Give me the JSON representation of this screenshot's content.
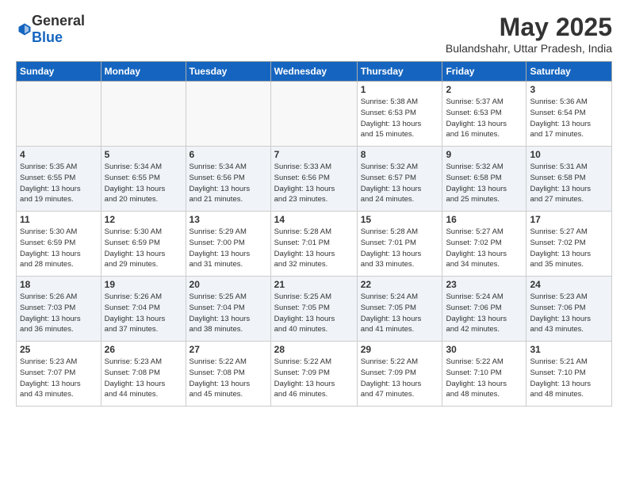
{
  "logo": {
    "general": "General",
    "blue": "Blue"
  },
  "header": {
    "title": "May 2025",
    "subtitle": "Bulandshahr, Uttar Pradesh, India"
  },
  "weekdays": [
    "Sunday",
    "Monday",
    "Tuesday",
    "Wednesday",
    "Thursday",
    "Friday",
    "Saturday"
  ],
  "weeks": [
    [
      {
        "day": "",
        "info": ""
      },
      {
        "day": "",
        "info": ""
      },
      {
        "day": "",
        "info": ""
      },
      {
        "day": "",
        "info": ""
      },
      {
        "day": "1",
        "info": "Sunrise: 5:38 AM\nSunset: 6:53 PM\nDaylight: 13 hours\nand 15 minutes."
      },
      {
        "day": "2",
        "info": "Sunrise: 5:37 AM\nSunset: 6:53 PM\nDaylight: 13 hours\nand 16 minutes."
      },
      {
        "day": "3",
        "info": "Sunrise: 5:36 AM\nSunset: 6:54 PM\nDaylight: 13 hours\nand 17 minutes."
      }
    ],
    [
      {
        "day": "4",
        "info": "Sunrise: 5:35 AM\nSunset: 6:55 PM\nDaylight: 13 hours\nand 19 minutes."
      },
      {
        "day": "5",
        "info": "Sunrise: 5:34 AM\nSunset: 6:55 PM\nDaylight: 13 hours\nand 20 minutes."
      },
      {
        "day": "6",
        "info": "Sunrise: 5:34 AM\nSunset: 6:56 PM\nDaylight: 13 hours\nand 21 minutes."
      },
      {
        "day": "7",
        "info": "Sunrise: 5:33 AM\nSunset: 6:56 PM\nDaylight: 13 hours\nand 23 minutes."
      },
      {
        "day": "8",
        "info": "Sunrise: 5:32 AM\nSunset: 6:57 PM\nDaylight: 13 hours\nand 24 minutes."
      },
      {
        "day": "9",
        "info": "Sunrise: 5:32 AM\nSunset: 6:58 PM\nDaylight: 13 hours\nand 25 minutes."
      },
      {
        "day": "10",
        "info": "Sunrise: 5:31 AM\nSunset: 6:58 PM\nDaylight: 13 hours\nand 27 minutes."
      }
    ],
    [
      {
        "day": "11",
        "info": "Sunrise: 5:30 AM\nSunset: 6:59 PM\nDaylight: 13 hours\nand 28 minutes."
      },
      {
        "day": "12",
        "info": "Sunrise: 5:30 AM\nSunset: 6:59 PM\nDaylight: 13 hours\nand 29 minutes."
      },
      {
        "day": "13",
        "info": "Sunrise: 5:29 AM\nSunset: 7:00 PM\nDaylight: 13 hours\nand 31 minutes."
      },
      {
        "day": "14",
        "info": "Sunrise: 5:28 AM\nSunset: 7:01 PM\nDaylight: 13 hours\nand 32 minutes."
      },
      {
        "day": "15",
        "info": "Sunrise: 5:28 AM\nSunset: 7:01 PM\nDaylight: 13 hours\nand 33 minutes."
      },
      {
        "day": "16",
        "info": "Sunrise: 5:27 AM\nSunset: 7:02 PM\nDaylight: 13 hours\nand 34 minutes."
      },
      {
        "day": "17",
        "info": "Sunrise: 5:27 AM\nSunset: 7:02 PM\nDaylight: 13 hours\nand 35 minutes."
      }
    ],
    [
      {
        "day": "18",
        "info": "Sunrise: 5:26 AM\nSunset: 7:03 PM\nDaylight: 13 hours\nand 36 minutes."
      },
      {
        "day": "19",
        "info": "Sunrise: 5:26 AM\nSunset: 7:04 PM\nDaylight: 13 hours\nand 37 minutes."
      },
      {
        "day": "20",
        "info": "Sunrise: 5:25 AM\nSunset: 7:04 PM\nDaylight: 13 hours\nand 38 minutes."
      },
      {
        "day": "21",
        "info": "Sunrise: 5:25 AM\nSunset: 7:05 PM\nDaylight: 13 hours\nand 40 minutes."
      },
      {
        "day": "22",
        "info": "Sunrise: 5:24 AM\nSunset: 7:05 PM\nDaylight: 13 hours\nand 41 minutes."
      },
      {
        "day": "23",
        "info": "Sunrise: 5:24 AM\nSunset: 7:06 PM\nDaylight: 13 hours\nand 42 minutes."
      },
      {
        "day": "24",
        "info": "Sunrise: 5:23 AM\nSunset: 7:06 PM\nDaylight: 13 hours\nand 43 minutes."
      }
    ],
    [
      {
        "day": "25",
        "info": "Sunrise: 5:23 AM\nSunset: 7:07 PM\nDaylight: 13 hours\nand 43 minutes."
      },
      {
        "day": "26",
        "info": "Sunrise: 5:23 AM\nSunset: 7:08 PM\nDaylight: 13 hours\nand 44 minutes."
      },
      {
        "day": "27",
        "info": "Sunrise: 5:22 AM\nSunset: 7:08 PM\nDaylight: 13 hours\nand 45 minutes."
      },
      {
        "day": "28",
        "info": "Sunrise: 5:22 AM\nSunset: 7:09 PM\nDaylight: 13 hours\nand 46 minutes."
      },
      {
        "day": "29",
        "info": "Sunrise: 5:22 AM\nSunset: 7:09 PM\nDaylight: 13 hours\nand 47 minutes."
      },
      {
        "day": "30",
        "info": "Sunrise: 5:22 AM\nSunset: 7:10 PM\nDaylight: 13 hours\nand 48 minutes."
      },
      {
        "day": "31",
        "info": "Sunrise: 5:21 AM\nSunset: 7:10 PM\nDaylight: 13 hours\nand 48 minutes."
      }
    ]
  ]
}
